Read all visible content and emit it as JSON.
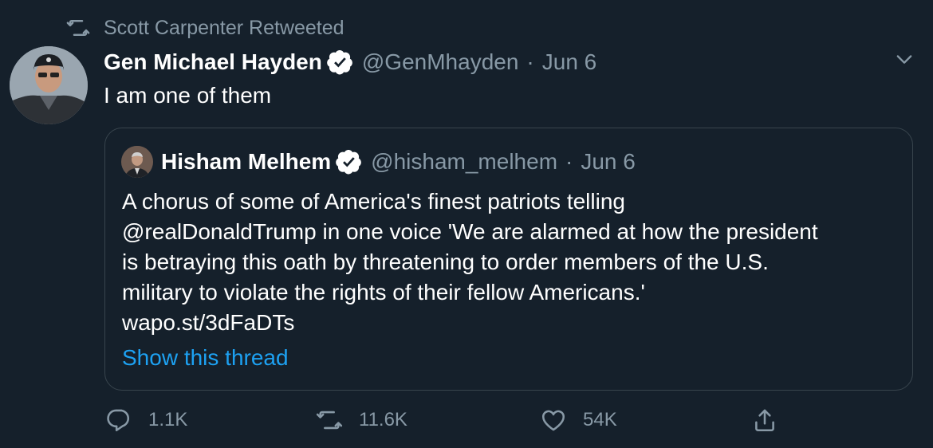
{
  "retweet": {
    "icon": "retweet-icon",
    "text": "Scott Carpenter Retweeted"
  },
  "tweet": {
    "author_name": "Gen Michael Hayden",
    "handle": "@GenMhayden",
    "separator": "·",
    "date": "Jun 6",
    "text": "I am one of them",
    "verified_icon": "verified-badge-icon",
    "menu_icon": "chevron-down-icon"
  },
  "quoted_tweet": {
    "author_name": "Hisham Melhem",
    "handle": "@hisham_melhem",
    "separator": "·",
    "date": "Jun 6",
    "lines": [
      "A chorus of some of America's finest patriots telling",
      "@realDonaldTrump in one voice 'We are alarmed at how the president",
      "is betraying this oath by threatening to order members of the U.S.",
      "military to violate the rights of their fellow Americans.'",
      "wapo.st/3dFaDTs"
    ],
    "show_thread": "Show this thread"
  },
  "actions": {
    "reply_count": "1.1K",
    "retweet_count": "11.6K",
    "like_count": "54K",
    "reply_icon": "reply-icon",
    "retweet_icon": "retweet-icon",
    "like_icon": "heart-icon",
    "share_icon": "share-icon"
  },
  "colors": {
    "background": "#15202b",
    "secondary_text": "#8899a6",
    "link": "#1da1f2",
    "border": "#38444d"
  }
}
